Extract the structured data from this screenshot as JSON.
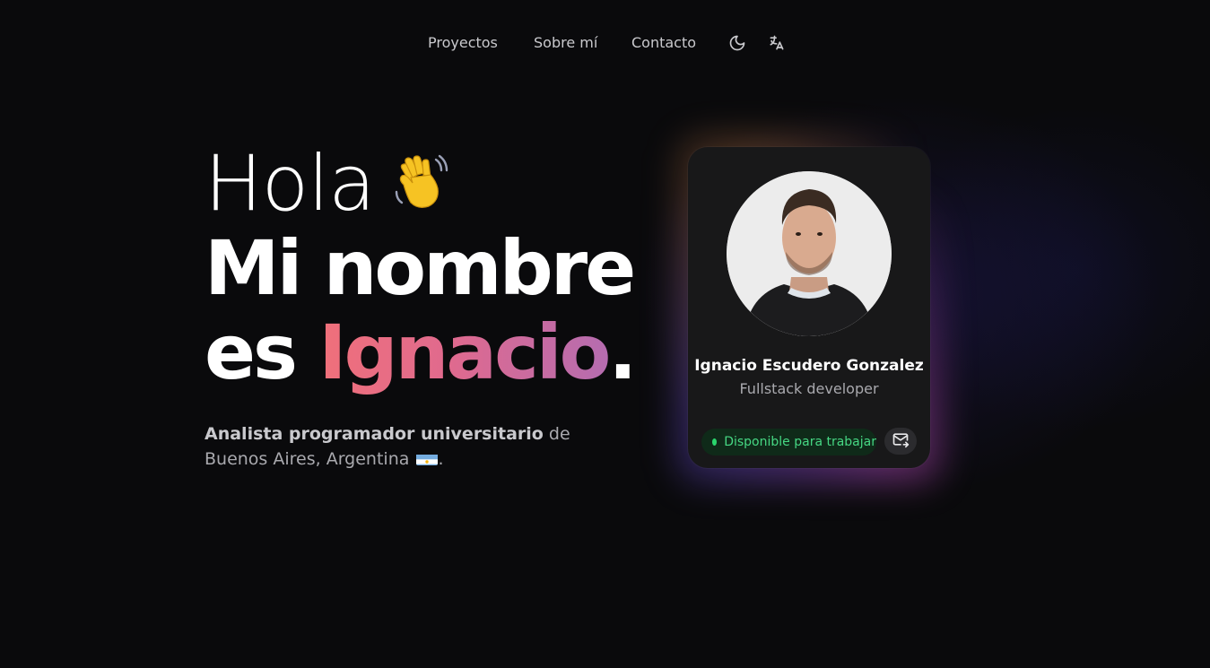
{
  "nav": {
    "links": [
      {
        "label": "Proyectos"
      },
      {
        "label": "Sobre mí"
      },
      {
        "label": "Contacto"
      }
    ],
    "icons": [
      "moon-icon",
      "translate-icon"
    ]
  },
  "hero": {
    "greeting": "Hola",
    "greeting_icon": "waving-hand-icon",
    "line2": "Mi nombre",
    "line3_prefix": "es",
    "name": "Ignacio",
    "name_suffix": ".",
    "subtitle_bold": "Analista programador universitario",
    "subtitle_rest": " de Buenos Aires, Argentina ",
    "subtitle_end": ".",
    "flag_icon": "argentina-flag-icon"
  },
  "card": {
    "name": "Ignacio Escudero Gonzalez",
    "role": "Fullstack developer",
    "status": "Disponible para trabajar",
    "status_color": "#2ad66d",
    "mail_icon": "mail-icon"
  },
  "colors": {
    "background": "#0a0a0c",
    "card": "#181819",
    "gradient_start": "#f0707a",
    "gradient_end": "#b56cb0"
  }
}
